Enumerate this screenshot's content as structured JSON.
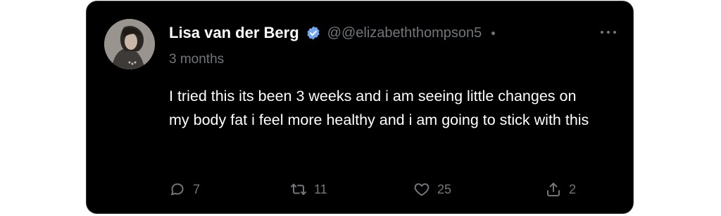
{
  "post": {
    "author_name": "Lisa van der Berg",
    "handle": "@@elizabeththompson5",
    "time": "3 months",
    "text": "I tried this its been 3 weeks and i am seeing little changes on my body fat i feel more healthy and i am going to stick with this",
    "verified_badge_icon": "verified-badge-icon",
    "verified_color": "#6fa8f0"
  },
  "actions": {
    "replies": "7",
    "reposts": "11",
    "likes": "25",
    "shares": "2"
  },
  "colors": {
    "card_background": "#000000",
    "border": "#2f3336",
    "primary_text": "#ffffff",
    "secondary_text": "#71767b"
  }
}
